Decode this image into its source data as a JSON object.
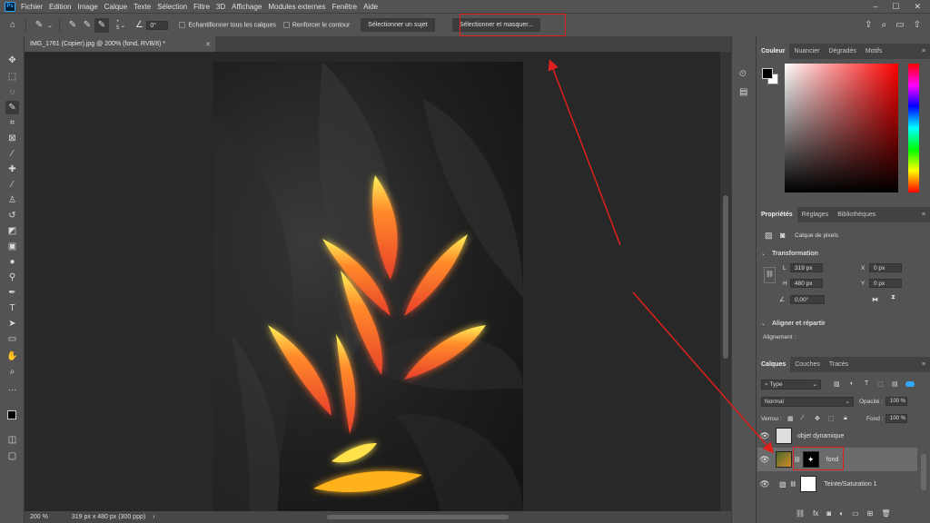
{
  "app": {
    "logo": "Ps"
  },
  "menu": [
    "Fichier",
    "Edition",
    "Image",
    "Calque",
    "Texte",
    "Sélection",
    "Filtre",
    "3D",
    "Affichage",
    "Modules externes",
    "Fenêtre",
    "Aide"
  ],
  "options_bar": {
    "brush_size": "5",
    "angle_value": "0°",
    "sample_all_label": "Echantillonner tous les calques",
    "enhance_edge_label": "Renforcer le contour",
    "select_subject_label": "Sélectionner un sujet",
    "select_mask_label": "Sélectionner et masquer..."
  },
  "document": {
    "tab_title": "IMG_1761 (Copier).jpg @ 200% (fond, RVB/8) *",
    "zoom": "200 %",
    "status": "319 px x 480 px (300 ppp)"
  },
  "color_panel": {
    "tabs": [
      "Couleur",
      "Nuancier",
      "Dégradés",
      "Motifs"
    ]
  },
  "properties_panel": {
    "tabs": [
      "Propriétés",
      "Réglages",
      "Bibliothèques"
    ],
    "pixel_layer_label": "Calque de pixels",
    "transform_title": "Transformation",
    "L_label": "L",
    "L_value": "319 px",
    "X_label": "X",
    "X_value": "0 px",
    "H_label": "H",
    "H_value": "480 px",
    "Y_label": "Y",
    "Y_value": "0 px",
    "angle_value": "0,00°",
    "align_title": "Aligner et répartir",
    "align_label": "Alignement :"
  },
  "layers_panel": {
    "tabs": [
      "Calques",
      "Couches",
      "Tracés"
    ],
    "filter_label": "Type",
    "blend_mode": "Normal",
    "opacity_label": "Opacité :",
    "opacity_value": "100 %",
    "lock_label": "Verrou :",
    "fill_label": "Fond :",
    "fill_value": "100 %",
    "layers": [
      "objet dynamique",
      "fond",
      "Teinte/Saturation 1"
    ]
  },
  "colors": {
    "annotation": "#e0201c",
    "panel_bg": "#535353",
    "canvas_bg": "#282828"
  }
}
